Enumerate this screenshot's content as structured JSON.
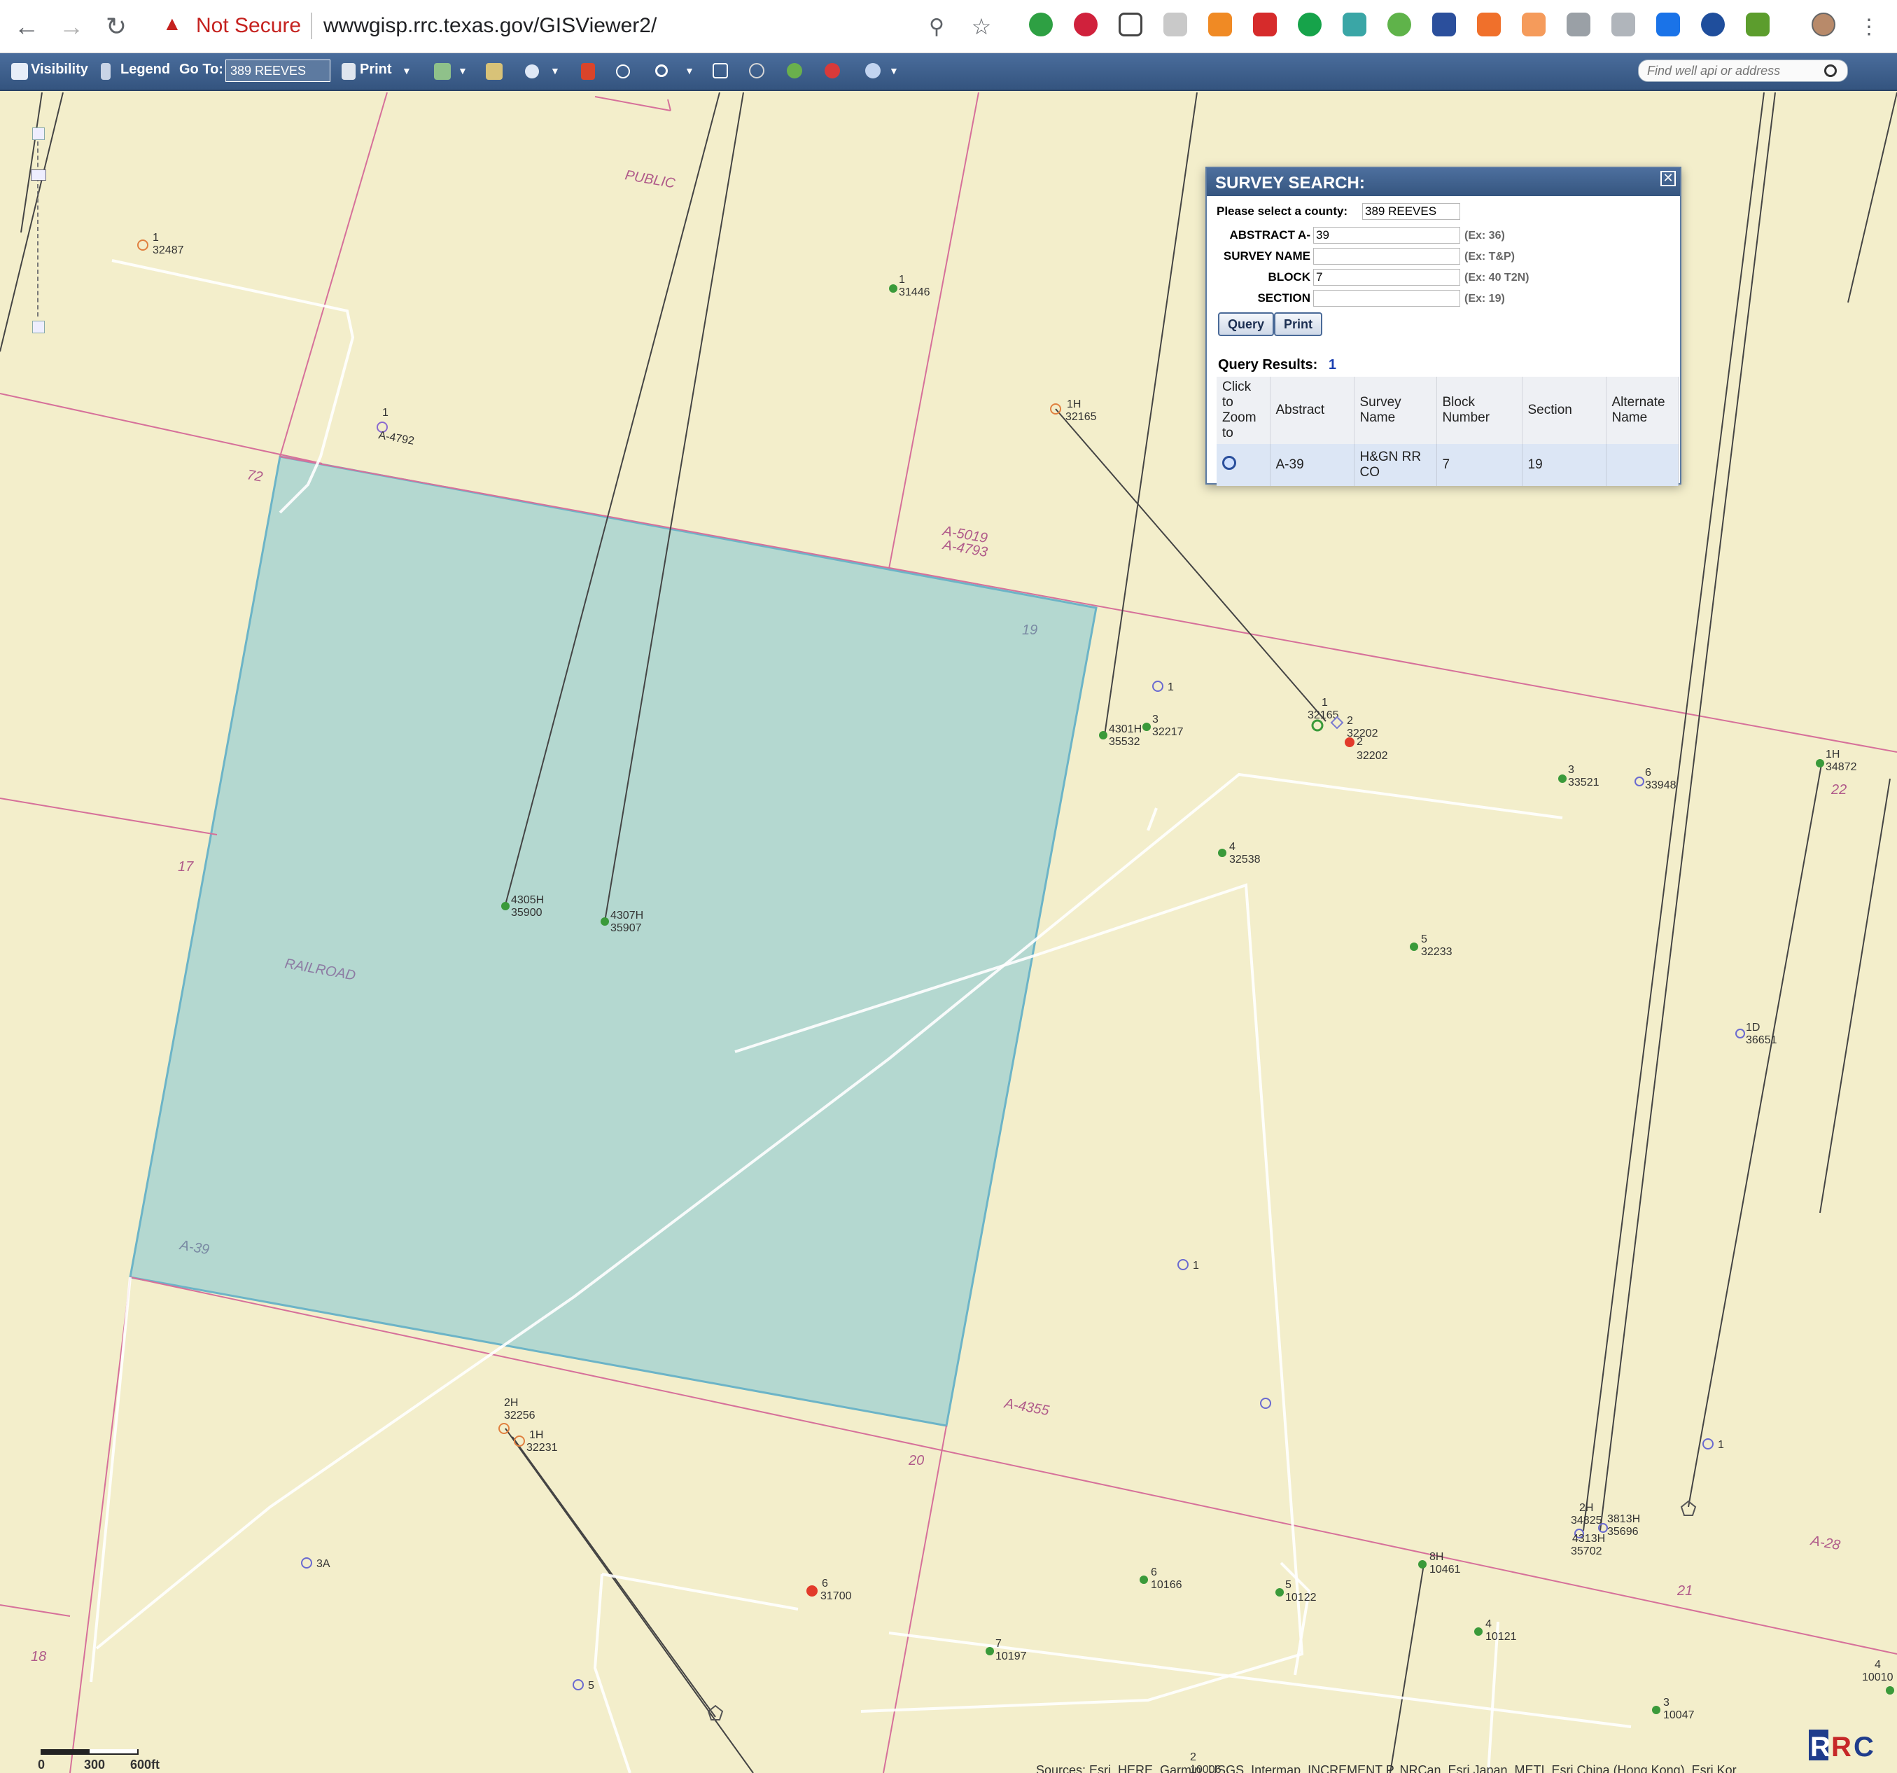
{
  "browser": {
    "security_label": "Not Secure",
    "url": "wwwgisp.rrc.texas.gov/GISViewer2/"
  },
  "toolbar": {
    "visibility": "Visibility",
    "legend": "Legend",
    "goto_label": "Go To:",
    "goto_value": "389 REEVES",
    "print": "Print",
    "find_placeholder": "Find well api or address"
  },
  "survey_search": {
    "title": "SURVEY SEARCH:",
    "county_label": "Please select a county:",
    "county_value": "389 REEVES",
    "abstract_label": "ABSTRACT A-",
    "abstract_value": "39",
    "abstract_example": "(Ex: 36)",
    "survey_name_label": "SURVEY NAME",
    "survey_name_value": "",
    "survey_name_example": "(Ex: T&P)",
    "block_label": "BLOCK",
    "block_value": "7",
    "block_example": "(Ex: 40 T2N)",
    "section_label": "SECTION",
    "section_value": "",
    "section_example": "(Ex: 19)",
    "query_button": "Query",
    "print_button": "Print",
    "results_label": "Query Results:",
    "results_count": "1",
    "columns": [
      "Click to Zoom to",
      "Abstract",
      "Survey Name",
      "Block Number",
      "Section",
      "Alternate Name"
    ],
    "rows": [
      {
        "abstract": "A-39",
        "survey_name": "H&GN RR CO",
        "block": "7",
        "section": "19",
        "alternate": ""
      }
    ]
  },
  "map": {
    "section_labels": [
      "72",
      "17",
      "19",
      "22",
      "20",
      "21",
      "18"
    ],
    "abstract_labels": [
      "A-5019",
      "A-4793",
      "A-4355",
      "A-28",
      "A-39"
    ],
    "survey_labels": [
      "PUBLIC",
      "RAILROAD"
    ],
    "wells": [
      {
        "n": "1",
        "id": "32487"
      },
      {
        "n": "1",
        "id": "31446"
      },
      {
        "n": "1",
        "id": "A-4792"
      },
      {
        "n": "1H",
        "id": "32165"
      },
      {
        "n": "1",
        "id": ""
      },
      {
        "n": "4301H",
        "id": "35532"
      },
      {
        "n": "3",
        "id": "32217"
      },
      {
        "n": "1",
        "id": "32165"
      },
      {
        "n": "2",
        "id": "32202"
      },
      {
        "n": "2",
        "id": "32202"
      },
      {
        "n": "3",
        "id": "33521"
      },
      {
        "n": "6",
        "id": "33948"
      },
      {
        "n": "1H",
        "id": "34872"
      },
      {
        "n": "4",
        "id": "32538"
      },
      {
        "n": "4305H",
        "id": "35900"
      },
      {
        "n": "4307H",
        "id": "35907"
      },
      {
        "n": "5",
        "id": "32233"
      },
      {
        "n": "1D",
        "id": "36651"
      },
      {
        "n": "1",
        "id": ""
      },
      {
        "n": "2H",
        "id": "32256"
      },
      {
        "n": "1H",
        "id": "32231"
      },
      {
        "n": "1",
        "id": ""
      },
      {
        "n": "2H",
        "id": "34825"
      },
      {
        "n": "3813H",
        "id": "35696"
      },
      {
        "n": "4313H",
        "id": "35702"
      },
      {
        "n": "3A",
        "id": ""
      },
      {
        "n": "6",
        "id": "31700"
      },
      {
        "n": "6",
        "id": "10166"
      },
      {
        "n": "5",
        "id": "10122"
      },
      {
        "n": "8H",
        "id": "10461"
      },
      {
        "n": "4",
        "id": "10121"
      },
      {
        "n": "7",
        "id": "10197"
      },
      {
        "n": "5",
        "id": ""
      },
      {
        "n": "3",
        "id": "10047"
      },
      {
        "n": "4",
        "id": "10010"
      },
      {
        "n": "2",
        "id": "10006"
      }
    ],
    "scale_labels": [
      "0",
      "300",
      "600ft"
    ],
    "attribution": "Sources: Esri, HERE, Garmin, USGS, Intermap, INCREMENT P, NRCan, Esri Japan, METI, Esri China (Hong Kong), Esri Kor"
  },
  "colors": {
    "toolbar": "#3b5b86",
    "map_bg": "#f3eecb",
    "survey_line": "#d6709a",
    "highlight_fill": "#9fd0d1",
    "well_green": "#3a9a3a",
    "well_red": "#e23a2a",
    "warning": "#c5221f"
  }
}
